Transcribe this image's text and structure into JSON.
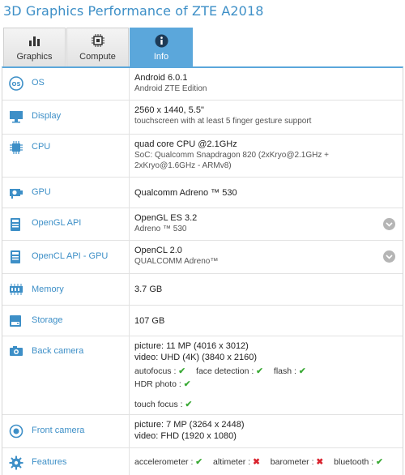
{
  "page_title": "3D Graphics Performance of ZTE A2018",
  "tabs": [
    {
      "label": "Graphics",
      "icon": "bar-chart-icon",
      "active": false
    },
    {
      "label": "Compute",
      "icon": "chip-icon",
      "active": false
    },
    {
      "label": "Info",
      "icon": "info-icon",
      "active": true
    }
  ],
  "rows": {
    "os": {
      "label": "OS",
      "icon": "os-icon",
      "main": "Android 6.0.1",
      "sub": "Android ZTE Edition"
    },
    "display": {
      "label": "Display",
      "icon": "monitor-icon",
      "main": "2560 x 1440, 5.5\"",
      "sub": "touchscreen with at least 5 finger gesture support"
    },
    "cpu": {
      "label": "CPU",
      "icon": "cpu-icon",
      "main": "quad core CPU @2.1GHz",
      "sub": "SoC: Qualcomm Snapdragon 820 (2xKryo@2.1GHz + 2xKryo@1.6GHz - ARMv8)"
    },
    "gpu": {
      "label": "GPU",
      "icon": "gpu-icon",
      "main": "Qualcomm Adreno ™ 530"
    },
    "opengl": {
      "label": "OpenGL API",
      "icon": "api-icon",
      "main": "OpenGL ES 3.2",
      "sub": "Adreno ™ 530"
    },
    "opencl": {
      "label": "OpenCL API - GPU",
      "icon": "api-icon",
      "main": "OpenCL 2.0",
      "sub": "QUALCOMM Adreno™"
    },
    "memory": {
      "label": "Memory",
      "icon": "memory-icon",
      "main": "3.7 GB"
    },
    "storage": {
      "label": "Storage",
      "icon": "storage-icon",
      "main": "107 GB"
    },
    "back_camera": {
      "label": "Back camera",
      "icon": "camera-icon",
      "line1": "picture: 11 MP (4016 x 3012)",
      "line2": "video: UHD (4K) (3840 x 2160)",
      "features": [
        {
          "name": "autofocus :",
          "supported": true
        },
        {
          "name": "face detection :",
          "supported": true
        },
        {
          "name": "flash :",
          "supported": true
        },
        {
          "name": "HDR photo :",
          "supported": true
        }
      ],
      "extra_feature": {
        "name": "touch focus :",
        "supported": true
      }
    },
    "front_camera": {
      "label": "Front camera",
      "icon": "front-camera-icon",
      "line1": "picture: 7 MP (3264 x 2448)",
      "line2": "video: FHD (1920 x 1080)"
    },
    "features": {
      "label": "Features",
      "icon": "gear-icon",
      "items": [
        {
          "name": "accelerometer :",
          "supported": true
        },
        {
          "name": "altimeter :",
          "supported": false
        },
        {
          "name": "barometer :",
          "supported": false
        },
        {
          "name": "bluetooth :",
          "supported": true
        }
      ]
    }
  },
  "check_mark": "✔",
  "cross_mark": "✖",
  "colors": {
    "accent": "#5ba7db",
    "link": "#3d8fc7",
    "ok": "#3aa935",
    "no": "#d9232e"
  }
}
